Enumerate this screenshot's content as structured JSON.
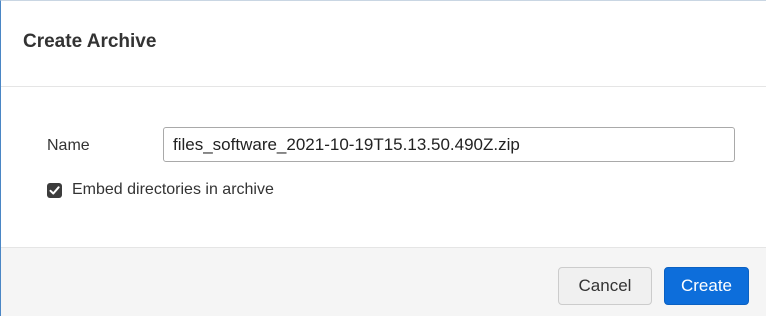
{
  "dialog": {
    "title": "Create Archive",
    "name_label": "Name",
    "name_value": "files_software_2021-10-19T15.13.50.490Z.zip",
    "embed_checkbox": {
      "label": "Embed directories in archive",
      "checked": true
    },
    "buttons": {
      "cancel": "Cancel",
      "create": "Create"
    }
  },
  "colors": {
    "primary_button": "#0d6edb",
    "footer_background": "#f5f5f5",
    "checkbox_fill": "#3c3c3c"
  },
  "icons": {
    "checkbox": "checkmark-icon"
  }
}
